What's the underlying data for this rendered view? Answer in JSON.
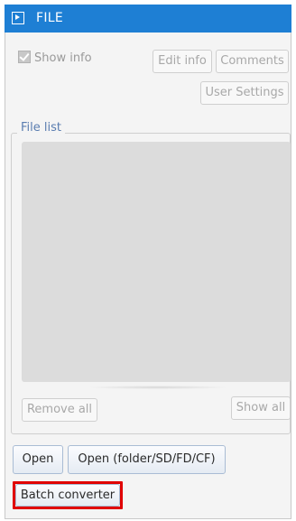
{
  "header": {
    "title": "FILE",
    "icon": "play-square-icon"
  },
  "options": {
    "show_info_label": "Show info",
    "show_info_checked": true,
    "edit_info_label": "Edit info",
    "comments_label": "Comments",
    "user_settings_label": "User Settings"
  },
  "file_list": {
    "legend": "File list",
    "remove_all_label": "Remove all",
    "show_all_label": "Show all"
  },
  "actions": {
    "open_label": "Open",
    "open_folder_label": "Open (folder/SD/FD/CF)",
    "batch_converter_label": "Batch converter"
  },
  "colors": {
    "header_bg": "#1e7fd4",
    "highlight": "#e00000"
  }
}
